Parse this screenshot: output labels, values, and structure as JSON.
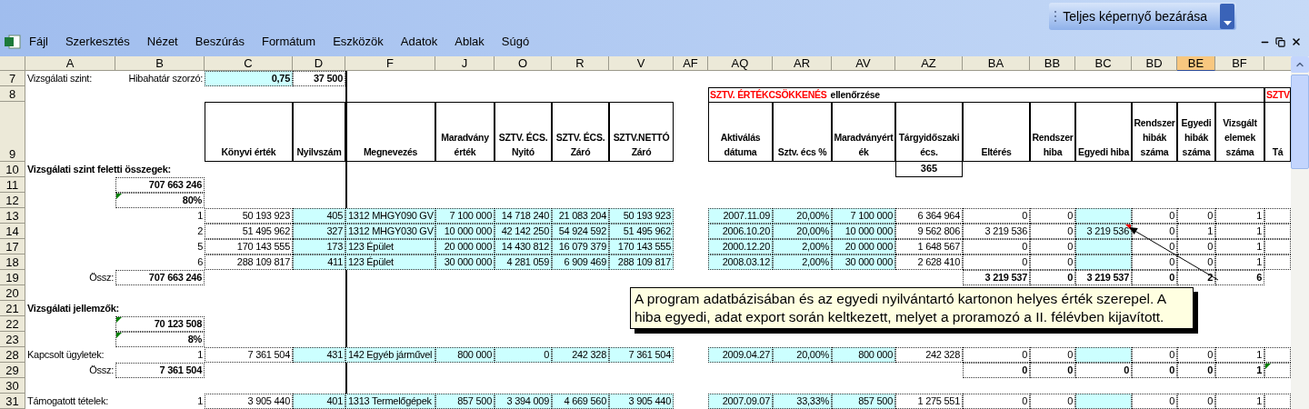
{
  "toolbar": {
    "button": "Teljes képernyő bezárása"
  },
  "menu": [
    "Fájl",
    "Szerkesztés",
    "Nézet",
    "Beszúrás",
    "Formátum",
    "Eszközök",
    "Adatok",
    "Ablak",
    "Súgó"
  ],
  "columns": [
    {
      "letter": "A",
      "selected": false
    },
    {
      "letter": "B",
      "selected": false
    },
    {
      "letter": "C",
      "selected": false
    },
    {
      "letter": "D",
      "selected": false
    },
    {
      "letter": "F",
      "selected": false
    },
    {
      "letter": "J",
      "selected": false
    },
    {
      "letter": "O",
      "selected": false
    },
    {
      "letter": "R",
      "selected": false
    },
    {
      "letter": "V",
      "selected": false
    },
    {
      "letter": "AF",
      "selected": false
    },
    {
      "letter": "AQ",
      "selected": false
    },
    {
      "letter": "AR",
      "selected": false
    },
    {
      "letter": "AV",
      "selected": false
    },
    {
      "letter": "AZ",
      "selected": false
    },
    {
      "letter": "BA",
      "selected": false
    },
    {
      "letter": "BB",
      "selected": false
    },
    {
      "letter": "BC",
      "selected": false
    },
    {
      "letter": "BD",
      "selected": false
    },
    {
      "letter": "BE",
      "selected": true
    },
    {
      "letter": "BF",
      "selected": false
    }
  ],
  "rows": [
    {
      "number": "7",
      "cells": [
        {
          "kind": "label",
          "text": "Vizsgálati szint:"
        },
        {
          "kind": "label_right",
          "text": "Hibahatár szorzó:"
        },
        {
          "kind": "total",
          "text": "0,75",
          "highlighted": true
        },
        {
          "kind": "total",
          "text": "37 500",
          "highlighted": false
        },
        {},
        {},
        {},
        {},
        {},
        {},
        {},
        {},
        {},
        {},
        {},
        {},
        {},
        {},
        {},
        {},
        {}
      ]
    },
    {
      "number": "8",
      "cells": [
        {},
        {},
        {},
        {},
        {},
        {},
        {},
        {},
        {},
        {},
        {
          "kind": "title",
          "parts": [
            {
              "text": "SZTV. ÉRTÉKCSÖKKENÉS",
              "color": "#ff0000"
            },
            {
              "text": "ellenőrzése",
              "color": "#000000"
            }
          ]
        },
        {},
        {},
        {},
        {},
        {},
        {},
        {},
        {},
        {},
        {
          "kind": "title",
          "parts": [
            {
              "text": "SZTV",
              "color": "#ff0000"
            }
          ]
        }
      ]
    },
    {
      "number": "9",
      "cells": [
        {},
        {},
        {
          "kind": "heading",
          "text": "Könyvi érték"
        },
        {
          "kind": "heading",
          "text": "Nyilvszám"
        },
        {
          "kind": "heading",
          "text": "Megnevezés"
        },
        {
          "kind": "heading",
          "text": "Maradvány érték"
        },
        {
          "kind": "heading",
          "text": "SZTV. ÉCS. Nyitó"
        },
        {
          "kind": "heading",
          "text": "SZTV. ÉCS. Záró"
        },
        {
          "kind": "heading",
          "text": "SZTV.NETTÓ Záró"
        },
        {},
        {
          "kind": "heading",
          "text": "Aktiválás dátuma"
        },
        {
          "kind": "heading",
          "text": "Sztv. écs %"
        },
        {
          "kind": "heading",
          "text": "Maradványérték"
        },
        {
          "kind": "heading",
          "text": "Tárgyidőszaki écs."
        },
        {
          "kind": "heading",
          "text": "Eltérés"
        },
        {
          "kind": "heading",
          "text": "Rendszer hiba"
        },
        {
          "kind": "heading",
          "text": "Egyedi hiba"
        },
        {
          "kind": "heading",
          "text": "Rendszer hibák száma"
        },
        {
          "kind": "heading",
          "text": "Egyedi hibák száma"
        },
        {
          "kind": "heading",
          "text": "Vizsgált elemek száma"
        },
        {
          "kind": "heading",
          "text": "Tá"
        }
      ]
    },
    {
      "number": "10",
      "cells": [
        {
          "kind": "label_bold",
          "text": "Vizsgálati szint feletti összegek:"
        },
        {},
        {},
        {},
        {},
        {},
        {},
        {},
        {},
        {},
        {},
        {},
        {},
        {
          "kind": "boxed",
          "text": "365"
        },
        {},
        {},
        {},
        {},
        {},
        {},
        {}
      ]
    },
    {
      "number": "11",
      "cells": [
        {},
        {
          "kind": "total",
          "text": "707 663 246",
          "highlighted": false
        },
        {},
        {},
        {},
        {},
        {},
        {},
        {},
        {},
        {},
        {},
        {},
        {},
        {},
        {},
        {},
        {},
        {},
        {},
        {}
      ]
    },
    {
      "number": "12",
      "cells": [
        {},
        {
          "kind": "total",
          "text": "80%",
          "highlighted": false,
          "error_flag": true
        },
        {},
        {},
        {},
        {},
        {},
        {},
        {},
        {},
        {},
        {},
        {},
        {},
        {},
        {},
        {},
        {},
        {},
        {},
        {}
      ]
    },
    {
      "number": "13",
      "cells": [
        {},
        {
          "kind": "label_right",
          "text": "1"
        },
        {
          "kind": "value",
          "text": "50 193 923",
          "highlighted": false
        },
        {
          "kind": "value",
          "text": "405",
          "highlighted": true
        },
        {
          "kind": "value",
          "text": "1312 MHGY090 GV",
          "highlighted": true
        },
        {
          "kind": "value",
          "text": "7 100 000",
          "highlighted": true
        },
        {
          "kind": "value",
          "text": "14 718 240",
          "highlighted": true
        },
        {
          "kind": "value",
          "text": "21 083 204",
          "highlighted": true
        },
        {
          "kind": "value",
          "text": "50 193 923",
          "highlighted": true
        },
        {},
        {
          "kind": "value",
          "text": "2007.11.09",
          "highlighted": true
        },
        {
          "kind": "value",
          "text": "20,00%",
          "highlighted": true
        },
        {
          "kind": "value",
          "text": "7 100 000",
          "highlighted": true
        },
        {
          "kind": "value",
          "text": "6 364 964",
          "highlighted": false
        },
        {
          "kind": "value",
          "text": "0",
          "highlighted": false
        },
        {
          "kind": "value",
          "text": "0",
          "highlighted": false
        },
        {
          "kind": "value",
          "highlighted": true
        },
        {
          "kind": "value",
          "text": "0",
          "highlighted": false
        },
        {
          "kind": "value",
          "text": "0",
          "highlighted": false
        },
        {
          "kind": "value",
          "text": "1",
          "highlighted": false
        },
        {
          "kind": "value",
          "highlighted": false
        }
      ]
    },
    {
      "number": "14",
      "cells": [
        {},
        {
          "kind": "label_right",
          "text": "2"
        },
        {
          "kind": "value",
          "text": "51 495 962",
          "highlighted": false
        },
        {
          "kind": "value",
          "text": "327",
          "highlighted": true
        },
        {
          "kind": "value",
          "text": "1312 MHGY030 GV",
          "highlighted": true
        },
        {
          "kind": "value",
          "text": "10 000 000",
          "highlighted": true
        },
        {
          "kind": "value",
          "text": "42 142 250",
          "highlighted": true
        },
        {
          "kind": "value",
          "text": "54 924 592",
          "highlighted": true
        },
        {
          "kind": "value",
          "text": "51 495 962",
          "highlighted": true
        },
        {},
        {
          "kind": "value",
          "text": "2006.10.20",
          "highlighted": true
        },
        {
          "kind": "value",
          "text": "20,00%",
          "highlighted": true
        },
        {
          "kind": "value",
          "text": "10 000 000",
          "highlighted": true
        },
        {
          "kind": "value",
          "text": "9 562 806",
          "highlighted": false
        },
        {
          "kind": "value",
          "text": "3 219 536",
          "highlighted": false
        },
        {
          "kind": "value",
          "text": "0",
          "highlighted": false
        },
        {
          "kind": "value",
          "text": "3 219 536",
          "highlighted": true,
          "comment_flag": true
        },
        {
          "kind": "value",
          "text": "0",
          "highlighted": false
        },
        {
          "kind": "value",
          "text": "1",
          "highlighted": false
        },
        {
          "kind": "value",
          "text": "1",
          "highlighted": false
        },
        {
          "kind": "value",
          "highlighted": false
        }
      ]
    },
    {
      "number": "17",
      "cells": [
        {},
        {
          "kind": "label_right",
          "text": "5"
        },
        {
          "kind": "value",
          "text": "170 143 555",
          "highlighted": false
        },
        {
          "kind": "value",
          "text": "173",
          "highlighted": true
        },
        {
          "kind": "value",
          "text": "123 Épület",
          "highlighted": true
        },
        {
          "kind": "value",
          "text": "20 000 000",
          "highlighted": true
        },
        {
          "kind": "value",
          "text": "14 430 812",
          "highlighted": true
        },
        {
          "kind": "value",
          "text": "16 079 379",
          "highlighted": true
        },
        {
          "kind": "value",
          "text": "170 143 555",
          "highlighted": true
        },
        {},
        {
          "kind": "value",
          "text": "2000.12.20",
          "highlighted": true
        },
        {
          "kind": "value",
          "text": "2,00%",
          "highlighted": true
        },
        {
          "kind": "value",
          "text": "20 000 000",
          "highlighted": true
        },
        {
          "kind": "value",
          "text": "1 648 567",
          "highlighted": false
        },
        {
          "kind": "value",
          "text": "0",
          "highlighted": false
        },
        {
          "kind": "value",
          "text": "0",
          "highlighted": false
        },
        {
          "kind": "value",
          "highlighted": true
        },
        {
          "kind": "value",
          "text": "0",
          "highlighted": false
        },
        {
          "kind": "value",
          "text": "0",
          "highlighted": false
        },
        {
          "kind": "value",
          "text": "1",
          "highlighted": false
        },
        {
          "kind": "value",
          "highlighted": false
        }
      ]
    },
    {
      "number": "18",
      "cells": [
        {},
        {
          "kind": "label_right",
          "text": "6"
        },
        {
          "kind": "value",
          "text": "288 109 817",
          "highlighted": false
        },
        {
          "kind": "value",
          "text": "411",
          "highlighted": true
        },
        {
          "kind": "value",
          "text": "123 Épület",
          "highlighted": true
        },
        {
          "kind": "value",
          "text": "30 000 000",
          "highlighted": true
        },
        {
          "kind": "value",
          "text": "4 281 059",
          "highlighted": true
        },
        {
          "kind": "value",
          "text": "6 909 469",
          "highlighted": true
        },
        {
          "kind": "value",
          "text": "288 109 817",
          "highlighted": true
        },
        {},
        {
          "kind": "value",
          "text": "2008.03.12",
          "highlighted": true
        },
        {
          "kind": "value",
          "text": "2,00%",
          "highlighted": true
        },
        {
          "kind": "value",
          "text": "30 000 000",
          "highlighted": true
        },
        {
          "kind": "value",
          "text": "2 628 410",
          "highlighted": false
        },
        {
          "kind": "value",
          "text": "0",
          "highlighted": false
        },
        {
          "kind": "value",
          "text": "0",
          "highlighted": false
        },
        {
          "kind": "value",
          "highlighted": true
        },
        {
          "kind": "value",
          "text": "0",
          "highlighted": false
        },
        {
          "kind": "value",
          "text": "0",
          "highlighted": false
        },
        {
          "kind": "value",
          "text": "1",
          "highlighted": false
        },
        {
          "kind": "value",
          "highlighted": false
        }
      ]
    },
    {
      "number": "19",
      "cells": [
        {
          "kind": "label_right",
          "text": "Össz:"
        },
        {
          "kind": "total",
          "text": "707 663 246",
          "highlighted": false
        },
        {},
        {},
        {},
        {},
        {},
        {},
        {},
        {},
        {},
        {},
        {},
        {},
        {
          "kind": "total",
          "text": "3 219 537",
          "highlighted": false
        },
        {
          "kind": "total",
          "text": "0",
          "highlighted": false
        },
        {
          "kind": "total",
          "text": "3 219 537",
          "highlighted": false
        },
        {
          "kind": "total",
          "text": "0",
          "highlighted": false
        },
        {
          "kind": "total",
          "text": "2",
          "highlighted": false
        },
        {
          "kind": "total",
          "text": "6",
          "highlighted": false
        },
        {}
      ]
    },
    {
      "number": "20"
    },
    {
      "number": "21",
      "cells": [
        {
          "kind": "label_bold",
          "text": "Vizsgálati jellemzők:"
        },
        {},
        {},
        {},
        {},
        {},
        {},
        {},
        {},
        {},
        {},
        {},
        {},
        {},
        {},
        {},
        {},
        {},
        {},
        {},
        {}
      ]
    },
    {
      "number": "22",
      "cells": [
        {},
        {
          "kind": "total",
          "text": "70 123 508",
          "highlighted": false,
          "error_flag": true
        },
        {},
        {},
        {},
        {},
        {},
        {},
        {},
        {},
        {},
        {},
        {},
        {},
        {},
        {},
        {},
        {},
        {},
        {},
        {}
      ]
    },
    {
      "number": "23",
      "cells": [
        {},
        {
          "kind": "total",
          "text": "8%",
          "highlighted": false,
          "error_flag": true
        },
        {},
        {},
        {},
        {},
        {},
        {},
        {},
        {},
        {},
        {},
        {},
        {},
        {},
        {},
        {},
        {},
        {},
        {},
        {}
      ]
    },
    {
      "number": "28",
      "cells": [
        {
          "kind": "label",
          "text": "Kapcsolt ügyletek:"
        },
        {
          "kind": "label_right",
          "text": "1"
        },
        {
          "kind": "value",
          "text": "7 361 504",
          "highlighted": false
        },
        {
          "kind": "value",
          "text": "431",
          "highlighted": true
        },
        {
          "kind": "value",
          "text": "142 Egyéb járművel",
          "highlighted": true
        },
        {
          "kind": "value",
          "text": "800 000",
          "highlighted": true
        },
        {
          "kind": "value",
          "text": "0",
          "highlighted": true
        },
        {
          "kind": "value",
          "text": "242 328",
          "highlighted": true
        },
        {
          "kind": "value",
          "text": "7 361 504",
          "highlighted": true
        },
        {},
        {
          "kind": "value",
          "text": "2009.04.27",
          "highlighted": true
        },
        {
          "kind": "value",
          "text": "20,00%",
          "highlighted": true
        },
        {
          "kind": "value",
          "text": "800 000",
          "highlighted": true
        },
        {
          "kind": "value",
          "text": "242 328",
          "highlighted": false
        },
        {
          "kind": "value",
          "text": "0",
          "highlighted": false
        },
        {
          "kind": "value",
          "text": "0",
          "highlighted": false
        },
        {
          "kind": "value",
          "highlighted": true
        },
        {
          "kind": "value",
          "text": "0",
          "highlighted": false
        },
        {
          "kind": "value",
          "text": "0",
          "highlighted": false
        },
        {
          "kind": "value",
          "text": "1",
          "highlighted": false
        },
        {
          "kind": "value",
          "highlighted": false
        }
      ]
    },
    {
      "number": "29",
      "cells": [
        {
          "kind": "label_right",
          "text": "Össz:"
        },
        {
          "kind": "total",
          "text": "7 361 504",
          "highlighted": false
        },
        {},
        {},
        {},
        {},
        {},
        {},
        {},
        {},
        {},
        {},
        {},
        {},
        {
          "kind": "total",
          "text": "0",
          "highlighted": false
        },
        {
          "kind": "total",
          "text": "0",
          "highlighted": false
        },
        {
          "kind": "total",
          "text": "0",
          "highlighted": false
        },
        {
          "kind": "total",
          "text": "0",
          "highlighted": false
        },
        {
          "kind": "total",
          "text": "0",
          "highlighted": false
        },
        {
          "kind": "total",
          "text": "1",
          "highlighted": false
        },
        {
          "kind": "value",
          "highlighted": false,
          "error_flag": true
        }
      ]
    },
    {
      "number": "30"
    },
    {
      "number": "31",
      "cells": [
        {
          "kind": "label",
          "text": "Támogatott tételek:"
        },
        {
          "kind": "label_right",
          "text": "1"
        },
        {
          "kind": "value",
          "text": "3 905 440",
          "highlighted": false
        },
        {
          "kind": "value",
          "text": "401",
          "highlighted": true
        },
        {
          "kind": "value",
          "text": "1313 Termelőgépek",
          "highlighted": true
        },
        {
          "kind": "value",
          "text": "857 500",
          "highlighted": true
        },
        {
          "kind": "value",
          "text": "3 394 009",
          "highlighted": true
        },
        {
          "kind": "value",
          "text": "4 669 560",
          "highlighted": true
        },
        {
          "kind": "value",
          "text": "3 905 440",
          "highlighted": true
        },
        {},
        {
          "kind": "value",
          "text": "2007.09.07",
          "highlighted": true
        },
        {
          "kind": "value",
          "text": "33,33%",
          "highlighted": true
        },
        {
          "kind": "value",
          "text": "857 500",
          "highlighted": true
        },
        {
          "kind": "value",
          "text": "1 275 551",
          "highlighted": false
        },
        {
          "kind": "value",
          "text": "0",
          "highlighted": false
        },
        {
          "kind": "value",
          "text": "0",
          "highlighted": false
        },
        {
          "kind": "value",
          "highlighted": true
        },
        {
          "kind": "value",
          "text": "0",
          "highlighted": false
        },
        {
          "kind": "value",
          "text": "0",
          "highlighted": false
        },
        {
          "kind": "value",
          "text": "1",
          "highlighted": false
        },
        {
          "kind": "value",
          "highlighted": false
        }
      ]
    }
  ],
  "comment": {
    "text": "A program adatbázisában és az egyedi nyilvántartó kartonon helyes érték szerepel. A hiba egyedi, adat export során keltkezett, melyet a proramozó a II. félévben kijavított."
  }
}
